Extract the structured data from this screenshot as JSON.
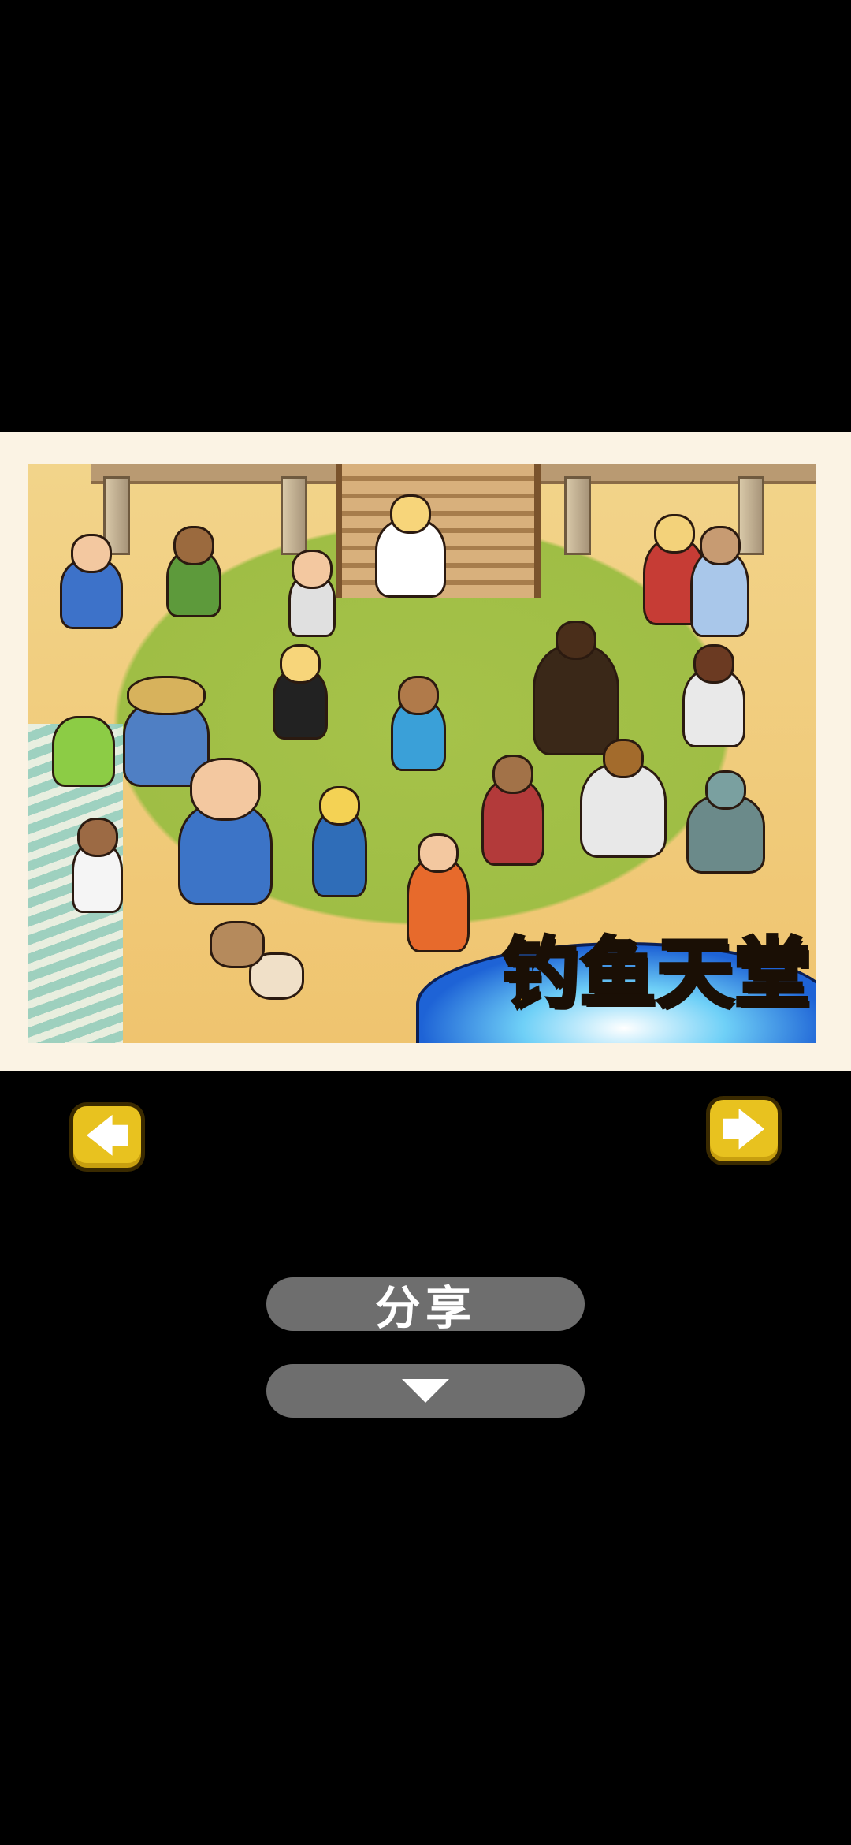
{
  "artwork": {
    "logo_text": "钓鱼天堂"
  },
  "nav": {
    "prev_icon": "arrow-left-icon",
    "next_icon": "arrow-right-icon",
    "prev_glyph": "🡄",
    "next_glyph": "🡆",
    "button_color": "#e8c21f"
  },
  "actions": {
    "share_label": "分享",
    "collapse_icon": "triangle-down-icon",
    "button_color": "#6e6e6e"
  }
}
